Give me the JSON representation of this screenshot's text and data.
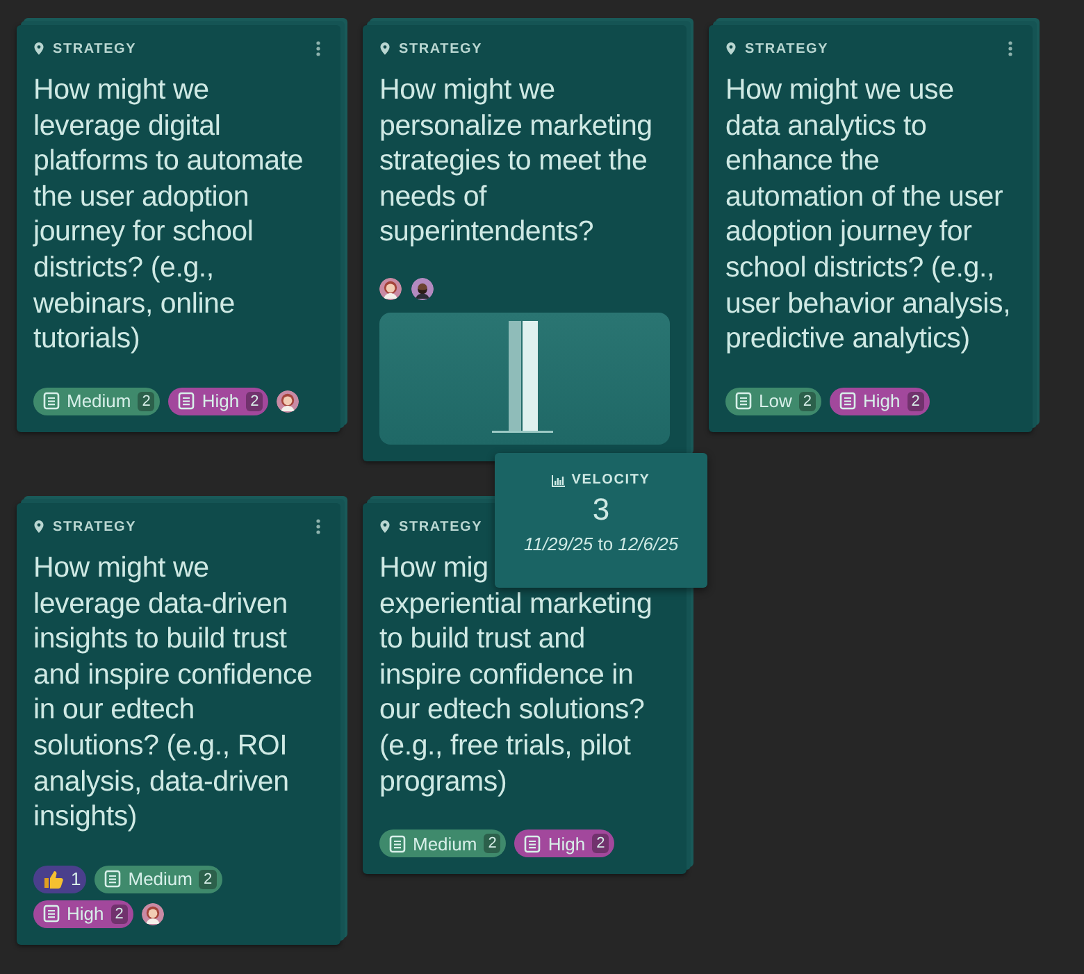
{
  "cards": [
    {
      "category": "STRATEGY",
      "menu": true,
      "question_parts": [
        "How might we leverage digital platforms to automate the user adoption journey for school districts? (e.g., webinars, online tutorials)"
      ],
      "tags": [
        {
          "kind": "priority",
          "label": "Medium",
          "count": "2",
          "color": "#3f8a6c"
        },
        {
          "kind": "priority",
          "label": "High",
          "count": "2",
          "color": "#a2489c"
        }
      ],
      "avatars": [
        {
          "kind": "woman"
        }
      ]
    },
    {
      "category": "STRATEGY",
      "menu": false,
      "question_parts": [
        "How might we personalize marketing strategies to meet the needs of superintendents?"
      ],
      "avatars": [
        {
          "kind": "woman"
        },
        {
          "kind": "man"
        }
      ],
      "velocity_panel": true
    },
    {
      "category": "STRATEGY",
      "menu": true,
      "question_parts": [
        "How might we use data analytics to enhance the automation of the user adoption journey for school districts? (e.g., user behavior analysis, predictive analytics)"
      ],
      "tags": [
        {
          "kind": "priority",
          "label": "Low",
          "count": "2",
          "color": "#3f8a6c"
        },
        {
          "kind": "priority",
          "label": "High",
          "count": "2",
          "color": "#a2489c"
        }
      ]
    },
    {
      "category": "STRATEGY",
      "menu": true,
      "question_parts": [
        "How might we leverage data-driven insights to build trust and inspire confidence in our edtech solutions? (e.g., ROI analysis, data-driven insights)"
      ],
      "tags": [
        {
          "kind": "votes",
          "label": "1",
          "color": "#4a3f8c"
        },
        {
          "kind": "priority",
          "label": "Medium",
          "count": "2",
          "color": "#3f8a6c"
        },
        {
          "kind": "priority",
          "label": "High",
          "count": "2",
          "color": "#a2489c"
        }
      ],
      "avatars": [
        {
          "kind": "woman"
        }
      ]
    },
    {
      "category": "STRATEGY",
      "menu": false,
      "question_parts": [
        "How mig",
        "experiential marketing to build trust and inspire confidence in our edtech solutions? (e.g., free trials, pilot programs)"
      ],
      "tags": [
        {
          "kind": "priority",
          "label": "Medium",
          "count": "2",
          "color": "#3f8a6c"
        },
        {
          "kind": "priority",
          "label": "High",
          "count": "2",
          "color": "#a2489c"
        }
      ]
    }
  ],
  "tooltip": {
    "label": "VELOCITY",
    "value": "3",
    "range": "*11/29/25* to *12/6/25*"
  }
}
